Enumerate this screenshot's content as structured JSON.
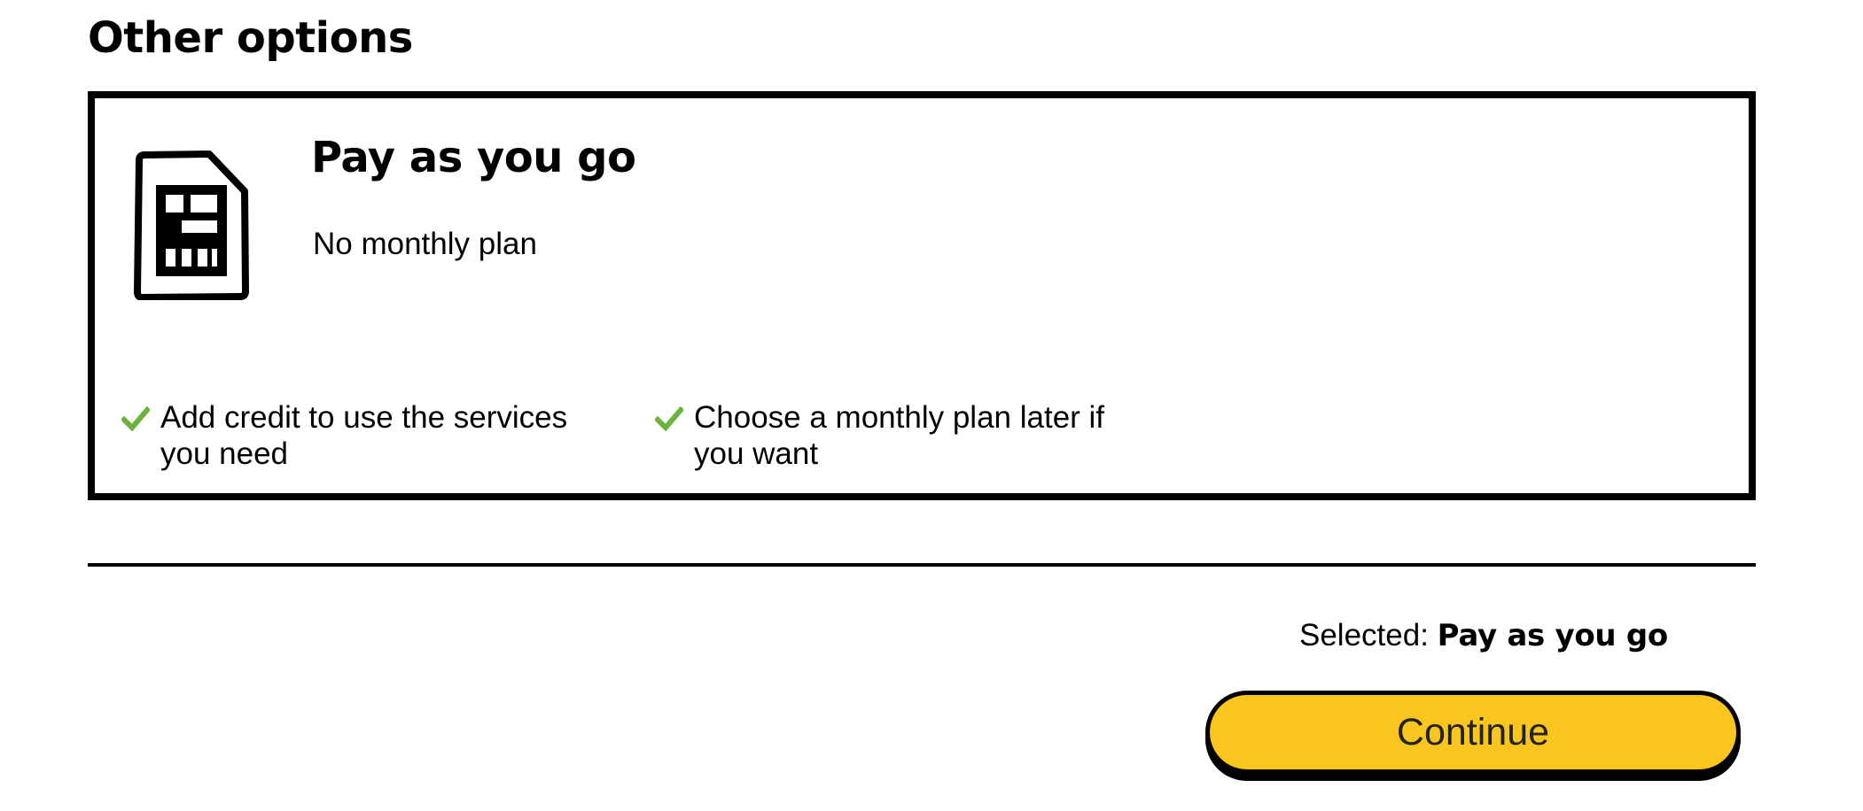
{
  "section": {
    "heading": "Other options"
  },
  "option_card": {
    "icon": "sim-card-icon",
    "title": "Pay as you go",
    "subtitle": "No monthly plan",
    "check_color": "#6cb33e",
    "features": [
      {
        "icon": "checkmark-icon",
        "text": "Add credit to use the services you need"
      },
      {
        "icon": "checkmark-icon",
        "text": "Choose a monthly plan later if you want"
      }
    ]
  },
  "summary": {
    "selected_label": "Selected:",
    "selected_value": "Pay as you go"
  },
  "actions": {
    "continue_label": "Continue",
    "continue_color": "#fac51c"
  }
}
